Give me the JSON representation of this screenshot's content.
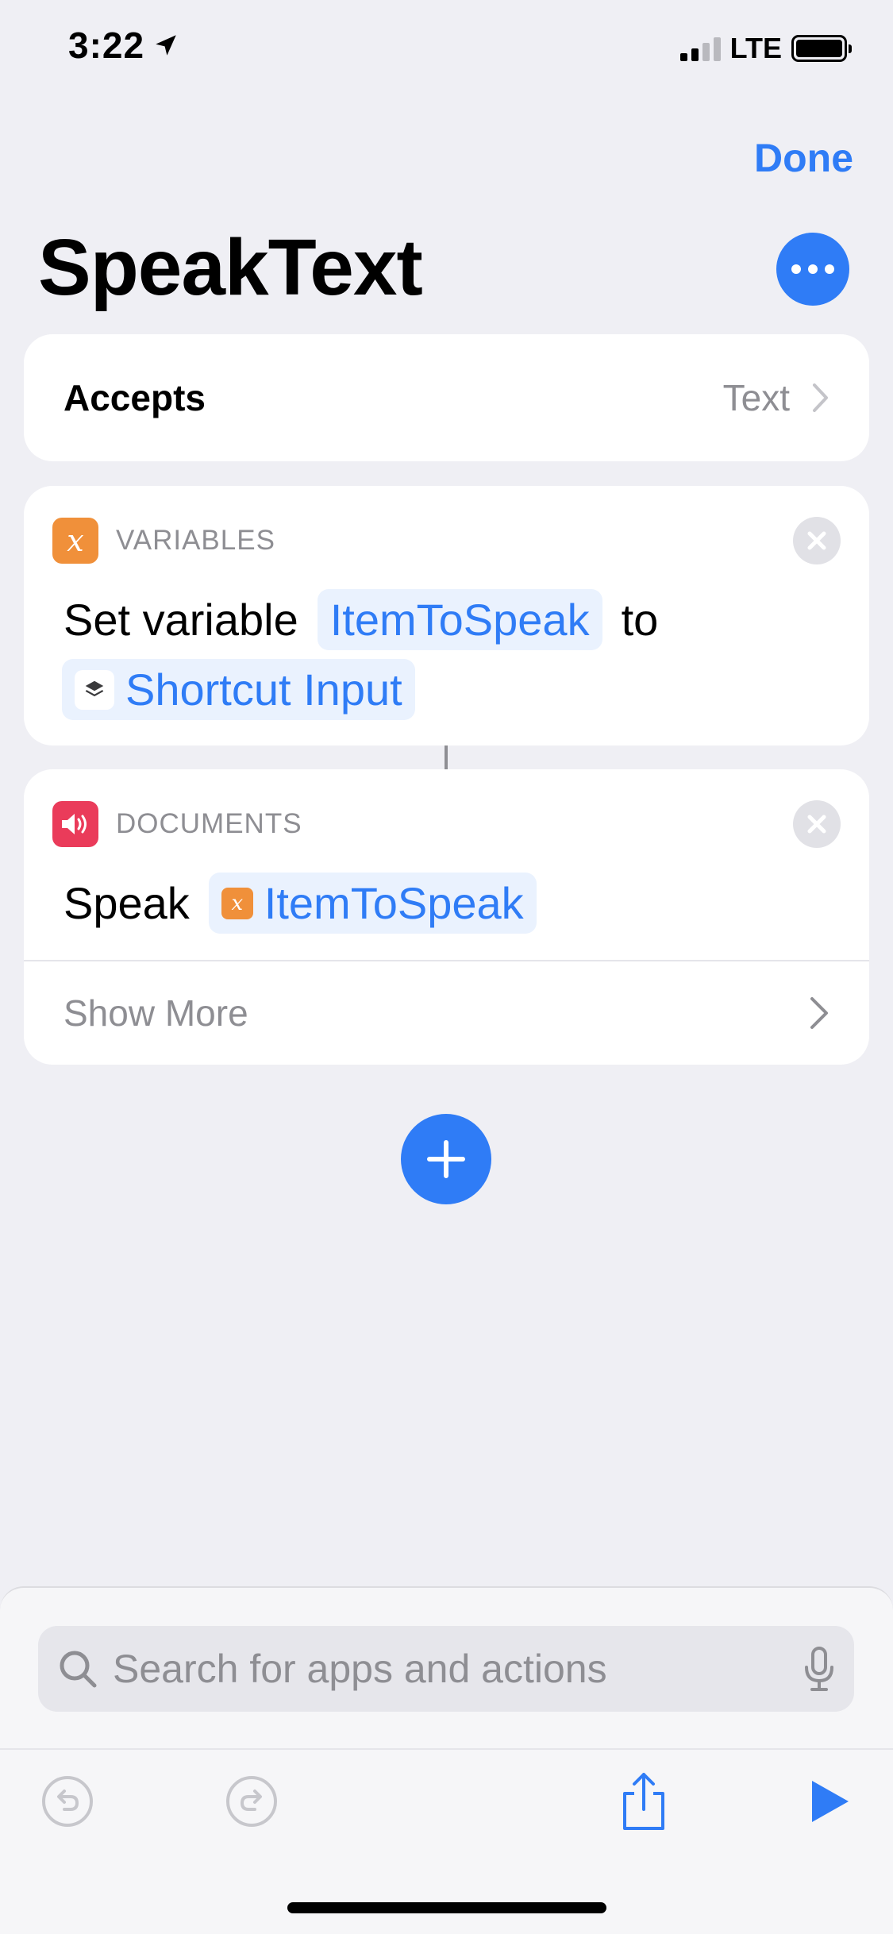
{
  "status_bar": {
    "time": "3:22",
    "network": "LTE"
  },
  "header": {
    "done_label": "Done",
    "title": "SpeakText"
  },
  "accepts": {
    "label": "Accepts",
    "value": "Text"
  },
  "actions": [
    {
      "category": "VARIABLES",
      "verb": "Set variable",
      "variable": "ItemToSpeak",
      "connector_word": "to",
      "input": "Shortcut Input"
    },
    {
      "category": "DOCUMENTS",
      "verb": "Speak",
      "variable": "ItemToSpeak",
      "show_more_label": "Show More"
    }
  ],
  "search": {
    "placeholder": "Search for apps and actions"
  },
  "colors": {
    "accent": "#2f7cf6",
    "variables": "#f0903a",
    "documents": "#ea3b5a",
    "background": "#efeff4"
  },
  "icons": [
    "location-arrow-icon",
    "signal-icon",
    "battery-icon",
    "more-icon",
    "variable-icon",
    "speaker-icon",
    "close-icon",
    "chevron-right-icon",
    "plus-icon",
    "search-icon",
    "microphone-icon",
    "undo-icon",
    "redo-icon",
    "share-icon",
    "play-icon"
  ]
}
